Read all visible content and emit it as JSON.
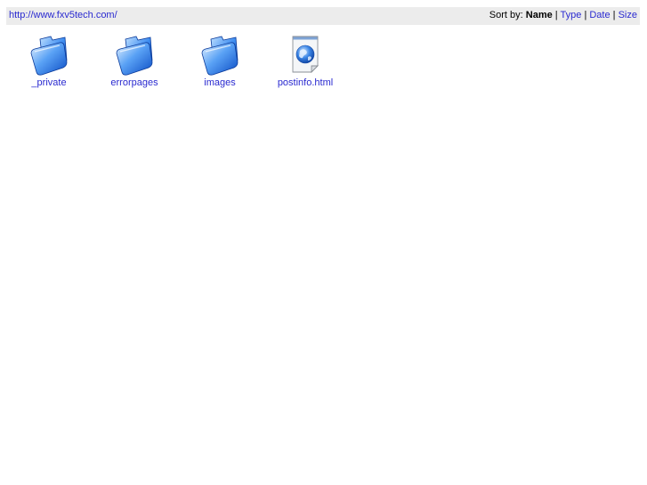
{
  "location": {
    "url": "http://www.fxv5tech.com/"
  },
  "sort": {
    "label": "Sort by:",
    "active": "Name",
    "options": [
      "Type",
      "Date",
      "Size"
    ],
    "separator": "|"
  },
  "items": [
    {
      "name": "_private",
      "icon": "folder-icon"
    },
    {
      "name": "errorpages",
      "icon": "folder-icon"
    },
    {
      "name": "images",
      "icon": "folder-icon"
    },
    {
      "name": "postinfo.html",
      "icon": "html-file-icon"
    }
  ],
  "colors": {
    "link": "#2a2ad0",
    "bar_bg": "#ececec",
    "folder_blue": "#2f7be8"
  }
}
